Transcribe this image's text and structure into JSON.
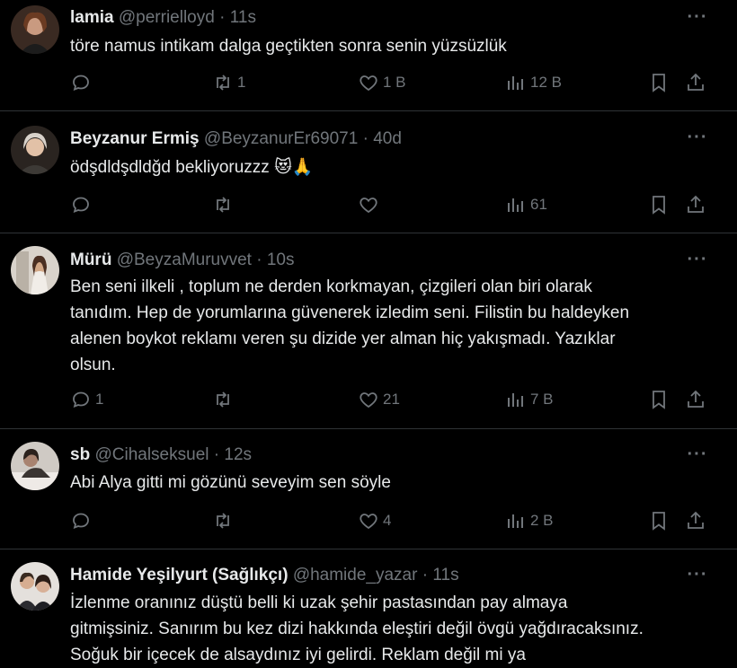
{
  "tweets": [
    {
      "name": "lamia",
      "handle": "@perrielloyd",
      "sep": "·",
      "time": "11s",
      "text": "töre namus intikam dalga geçtikten sonra senin yüzsüzlük",
      "replies": "",
      "retweets": "1",
      "likes": "1 B",
      "views": "12 B",
      "avatar_color": "#7a4b3a"
    },
    {
      "name": "Beyzanur Ermiş",
      "handle": "@BeyzanurEr69071",
      "sep": "·",
      "time": "40d",
      "text": "ödşdldşdldğd bekliyoruzzz 😻🙏",
      "replies": "",
      "retweets": "",
      "likes": "",
      "views": "61",
      "avatar_color": "#4a4038"
    },
    {
      "name": "Mürü",
      "handle": "@BeyzaMuruvvet",
      "sep": "·",
      "time": "10s",
      "text": "Ben seni ilkeli , toplum ne derden korkmayan, çizgileri olan biri olarak\ntanıdım. Hep de yorumlarına güvenerek izledim seni. Filistin bu haldeyken\nalenen boykot reklamı veren şu dizide yer alman hiç yakışmadı. Yazıklar\nolsun.",
      "replies": "1",
      "retweets": "",
      "likes": "21",
      "views": "7 B",
      "avatar_color": "#c9c2b8"
    },
    {
      "name": "sb",
      "handle": "@Cihalseksuel",
      "sep": "·",
      "time": "12s",
      "text": "Abi Alya gitti mi gözünü seveyim sen söyle",
      "replies": "",
      "retweets": "",
      "likes": "4",
      "views": "2 B",
      "avatar_color": "#b8b4b0"
    },
    {
      "name": "Hamide Yeşilyurt (Sağlıkçı)",
      "handle": "@hamide_yazar",
      "sep": "·",
      "time": "11s",
      "text": "İzlenme oranınız düştü belli ki uzak şehir pastasından pay almaya\ngitmişsiniz. Sanırım bu kez dizi hakkında eleştiri değil övgü yağdıracaksınız.\nSoğuk bir içecek de alsaydınız iyi gelirdi. Reklam değil mi ya",
      "replies": "",
      "retweets": "",
      "likes": "",
      "views": "",
      "avatar_color": "#d9d4cf"
    }
  ],
  "more_label": "···",
  "icons": {
    "reply": "reply-icon",
    "retweet": "retweet-icon",
    "like": "like-icon",
    "views": "views-icon",
    "bookmark": "bookmark-icon",
    "share": "share-icon"
  }
}
